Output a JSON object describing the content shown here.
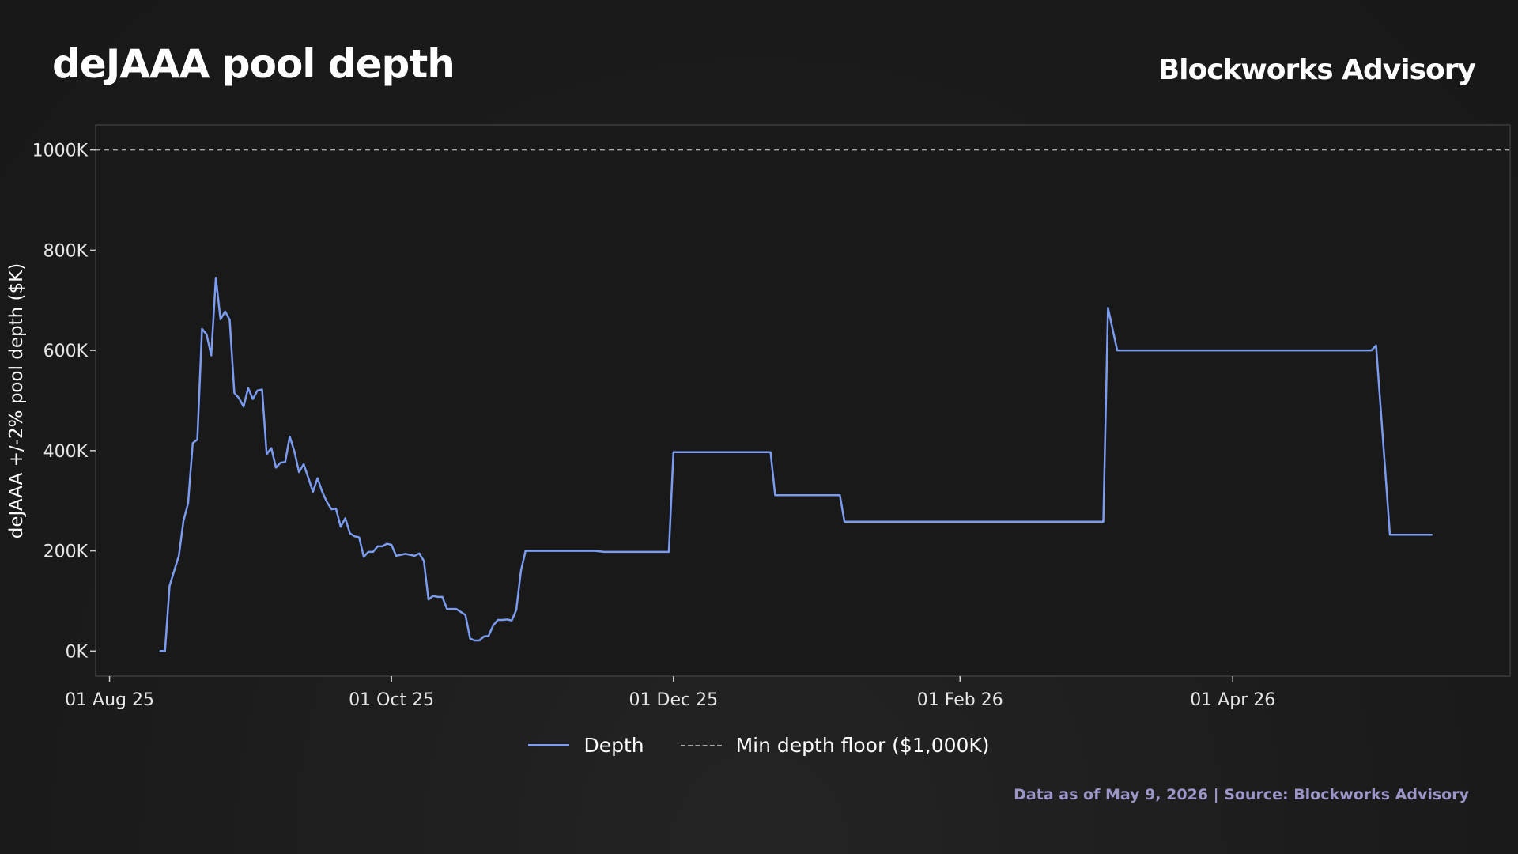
{
  "header": {
    "title": "deJAAA pool depth",
    "brand": "Blockworks Advisory"
  },
  "footer": {
    "source": "Data as of May 9, 2026 | Source: Blockworks Advisory"
  },
  "legend": {
    "depth_label": "Depth",
    "floor_label": "Min depth floor ($1,000K)"
  },
  "colors": {
    "depth_line": "#7b9cf0",
    "floor_line": "#a8a8a8",
    "background": "#1b1b1b",
    "footer_text": "#9b96c8"
  },
  "chart_data": {
    "type": "line",
    "title": "deJAAA pool depth",
    "ylabel": "deJAAA +/-2% pool depth ($K)",
    "xlabel": "",
    "ylim": [
      -50,
      1050
    ],
    "xlim": [
      "2025-07-29",
      "2026-05-31"
    ],
    "y_ticks": [
      0,
      200,
      400,
      600,
      800,
      1000
    ],
    "y_tick_labels": [
      "0K",
      "200K",
      "400K",
      "600K",
      "800K",
      "1000K"
    ],
    "x_ticks": [
      "2025-08-01",
      "2025-10-01",
      "2025-12-01",
      "2026-02-01",
      "2026-04-01"
    ],
    "x_tick_labels": [
      "01 Aug 25",
      "01 Oct 25",
      "01 Dec 25",
      "01 Feb 26",
      "01 Apr 26"
    ],
    "grid": false,
    "legend_position": "bottom-center",
    "reference_lines": [
      {
        "name": "Min depth floor ($1,000K)",
        "y": 1000,
        "style": "dashed"
      }
    ],
    "series": [
      {
        "name": "Depth",
        "dates": [
          "2025-08-12",
          "2025-08-13",
          "2025-08-14",
          "2025-08-16",
          "2025-08-17",
          "2025-08-18",
          "2025-08-19",
          "2025-08-20",
          "2025-08-21",
          "2025-08-22",
          "2025-08-23",
          "2025-08-24",
          "2025-08-25",
          "2025-08-26",
          "2025-08-27",
          "2025-08-28",
          "2025-08-29",
          "2025-08-30",
          "2025-08-31",
          "2025-09-01",
          "2025-09-02",
          "2025-09-03",
          "2025-09-04",
          "2025-09-05",
          "2025-09-06",
          "2025-09-07",
          "2025-09-08",
          "2025-09-09",
          "2025-09-10",
          "2025-09-11",
          "2025-09-12",
          "2025-09-13",
          "2025-09-14",
          "2025-09-15",
          "2025-09-16",
          "2025-09-17",
          "2025-09-18",
          "2025-09-19",
          "2025-09-20",
          "2025-09-21",
          "2025-09-22",
          "2025-09-23",
          "2025-09-24",
          "2025-09-25",
          "2025-09-26",
          "2025-09-27",
          "2025-09-28",
          "2025-09-29",
          "2025-09-30",
          "2025-10-01",
          "2025-10-02",
          "2025-10-03",
          "2025-10-04",
          "2025-10-05",
          "2025-10-06",
          "2025-10-07",
          "2025-10-08",
          "2025-10-09",
          "2025-10-10",
          "2025-10-11",
          "2025-10-12",
          "2025-10-13",
          "2025-10-14",
          "2025-10-15",
          "2025-10-16",
          "2025-10-17",
          "2025-10-18",
          "2025-10-19",
          "2025-10-20",
          "2025-10-21",
          "2025-10-22",
          "2025-10-23",
          "2025-10-24",
          "2025-10-25",
          "2025-10-26",
          "2025-10-27",
          "2025-10-28",
          "2025-10-29",
          "2025-10-30",
          "2025-10-31",
          "2025-11-01",
          "2025-11-02",
          "2025-11-03",
          "2025-11-04",
          "2025-11-05",
          "2025-11-06",
          "2025-11-07",
          "2025-11-08",
          "2025-11-09",
          "2025-11-10",
          "2025-11-11",
          "2025-11-12",
          "2025-11-13",
          "2025-11-14",
          "2025-11-15",
          "2025-11-16",
          "2025-11-20",
          "2025-11-30",
          "2025-12-01",
          "2025-12-22",
          "2025-12-23",
          "2026-01-06",
          "2026-01-07",
          "2026-03-04",
          "2026-03-05",
          "2026-03-07",
          "2026-05-01",
          "2026-05-02",
          "2026-05-05",
          "2026-05-14"
        ],
        "values": [
          0,
          0,
          130,
          190,
          260,
          295,
          415,
          422,
          643,
          632,
          590,
          745,
          662,
          678,
          661,
          515,
          505,
          488,
          525,
          503,
          520,
          522,
          393,
          405,
          366,
          376,
          377,
          428,
          398,
          357,
          373,
          346,
          318,
          345,
          318,
          298,
          283,
          284,
          248,
          265,
          235,
          229,
          227,
          188,
          198,
          198,
          209,
          209,
          214,
          212,
          190,
          192,
          194,
          192,
          190,
          195,
          180,
          103,
          110,
          108,
          108,
          84,
          84,
          84,
          78,
          72,
          25,
          21,
          21,
          29,
          30,
          51,
          62,
          62,
          63,
          61,
          82,
          160,
          200,
          200,
          200,
          200,
          200,
          200,
          200,
          200,
          200,
          200,
          200,
          200,
          200,
          200,
          200,
          200,
          199,
          198,
          198,
          198,
          397,
          397,
          311,
          311,
          258,
          258,
          685,
          600,
          600,
          610,
          232,
          232
        ]
      }
    ]
  }
}
